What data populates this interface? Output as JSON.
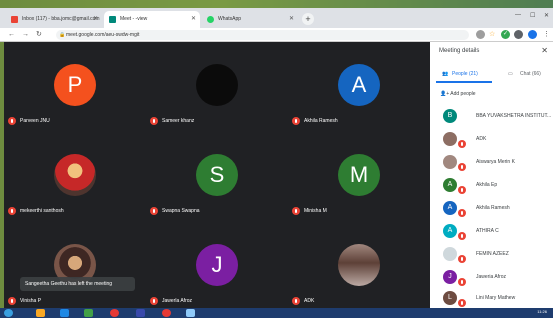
{
  "browser": {
    "tabs": [
      {
        "label": "Inbox (117) - bba.jomc@gmail.com",
        "icon": "gmail-icon",
        "color": "#ea4335"
      },
      {
        "label": "Meet - -view",
        "icon": "meet-icon",
        "color": "#00897b"
      },
      {
        "label": "WhatsApp",
        "icon": "whatsapp-icon",
        "color": "#25d366"
      }
    ],
    "new_tab": "+",
    "url": "meet.google.com/aeu-swdw-mgit"
  },
  "meet": {
    "tiles": [
      {
        "name": "Parveen JNU",
        "initial": "P",
        "color": "#f4511e",
        "type": "letter"
      },
      {
        "name": "Sameer khanz",
        "initial": "",
        "color": "#0b0b0b",
        "type": "letter"
      },
      {
        "name": "Akhila Ramesh",
        "initial": "A",
        "color": "#1565c0",
        "type": "letter"
      },
      {
        "name": "mekeerthi santhosh",
        "initial": "",
        "color": "#8d3b2f",
        "type": "photo"
      },
      {
        "name": "Swapna Swapna",
        "initial": "S",
        "color": "#2e7d32",
        "type": "letter"
      },
      {
        "name": "Minisha M",
        "initial": "M",
        "color": "#2e7d32",
        "type": "letter"
      },
      {
        "name": "Vinisha P",
        "initial": "",
        "color": "#6d4c41",
        "type": "photo"
      },
      {
        "name": "Jawerla Afroz",
        "initial": "J",
        "color": "#7b1fa2",
        "type": "letter"
      },
      {
        "name": "ADK",
        "initial": "",
        "color": "#8d6e63",
        "type": "photo"
      }
    ],
    "toast": "Sangeetha Geethu has left the meeting"
  },
  "panel": {
    "title": "Meeting details",
    "tab_people": "People (21)",
    "tab_chat": "Chat (66)",
    "add_people": "Add people",
    "participants": [
      {
        "name": "BBA YUVAKSHETRA INSTITUT...",
        "initial": "B",
        "color": "#00897b"
      },
      {
        "name": "ADK",
        "initial": "",
        "color": "#8d6e63"
      },
      {
        "name": "Aiswarya Merin K",
        "initial": "",
        "color": "#a1887f"
      },
      {
        "name": "Akhila Ep",
        "initial": "A",
        "color": "#2e7d32"
      },
      {
        "name": "Akhila Ramesh",
        "initial": "A",
        "color": "#1565c0"
      },
      {
        "name": "ATHIRA C",
        "initial": "A",
        "color": "#00acc1"
      },
      {
        "name": "FEMIN AZEEZ",
        "initial": "",
        "color": "#cfd8dc"
      },
      {
        "name": "Jaweria Afroz",
        "initial": "J",
        "color": "#7b1fa2"
      },
      {
        "name": "Lini Mary Mathew",
        "initial": "L",
        "color": "#6d4c41"
      }
    ]
  },
  "taskbar": {
    "clock": "11:26"
  }
}
